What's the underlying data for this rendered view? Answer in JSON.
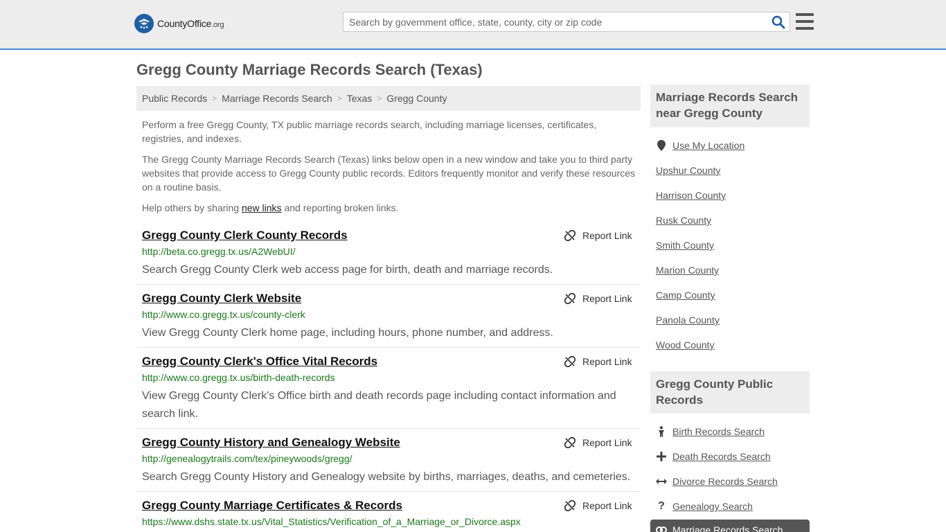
{
  "header": {
    "logo_name": "CountyOffice",
    "logo_suffix": ".org",
    "search_placeholder": "Search by government office, state, county, city or zip code"
  },
  "page_title": "Gregg County Marriage Records Search (Texas)",
  "breadcrumb": [
    "Public Records",
    "Marriage Records Search",
    "Texas",
    "Gregg County"
  ],
  "intro": {
    "p1": "Perform a free Gregg County, TX public marriage records search, including marriage licenses, certificates, registries, and indexes.",
    "p2": "The Gregg County Marriage Records Search (Texas) links below open in a new window and take you to third party websites that provide access to Gregg County public records. Editors frequently monitor and verify these resources on a routine basis.",
    "p3_before": "Help others by sharing ",
    "p3_link": "new links",
    "p3_after": " and reporting broken links."
  },
  "report_label": "Report Link",
  "results": [
    {
      "title": "Gregg County Clerk County Records",
      "url": "http://beta.co.gregg.tx.us/A2WebUI/",
      "desc": "Search Gregg County Clerk web access page for birth, death and marriage records."
    },
    {
      "title": "Gregg County Clerk Website",
      "url": "http://www.co.gregg.tx.us/county-clerk",
      "desc": "View Gregg County Clerk home page, including hours, phone number, and address."
    },
    {
      "title": "Gregg County Clerk's Office Vital Records",
      "url": "http://www.co.gregg.tx.us/birth-death-records",
      "desc": "View Gregg County Clerk's Office birth and death records page including contact information and search link."
    },
    {
      "title": "Gregg County History and Genealogy Website",
      "url": "http://genealogytrails.com/tex/pineywoods/gregg/",
      "desc": "Search Gregg County History and Genealogy website by births, marriages, deaths, and cemeteries."
    },
    {
      "title": "Gregg County Marriage Certificates & Records",
      "url": "https://www.dshs.state.tx.us/Vital_Statistics/Verification_of_a_Marriage_or_Divorce.aspx",
      "desc": ""
    }
  ],
  "sidebar": {
    "nearby_heading": "Marriage Records Search near Gregg County",
    "use_location": "Use My Location",
    "nearby": [
      "Upshur County",
      "Harrison County",
      "Rusk County",
      "Smith County",
      "Marion County",
      "Camp County",
      "Panola County",
      "Wood County"
    ],
    "public_heading": "Gregg County Public Records",
    "public_links": [
      {
        "label": "Birth Records Search",
        "icon": "person-icon"
      },
      {
        "label": "Death Records Search",
        "icon": "cross-icon"
      },
      {
        "label": "Divorce Records Search",
        "icon": "arrows-icon"
      },
      {
        "label": "Genealogy Search",
        "icon": "question-icon"
      }
    ],
    "active_link": "Marriage Records Search"
  },
  "colors": {
    "accent": "#4a8bd8",
    "link_url": "#1a7a1a",
    "panel": "#ededed"
  }
}
